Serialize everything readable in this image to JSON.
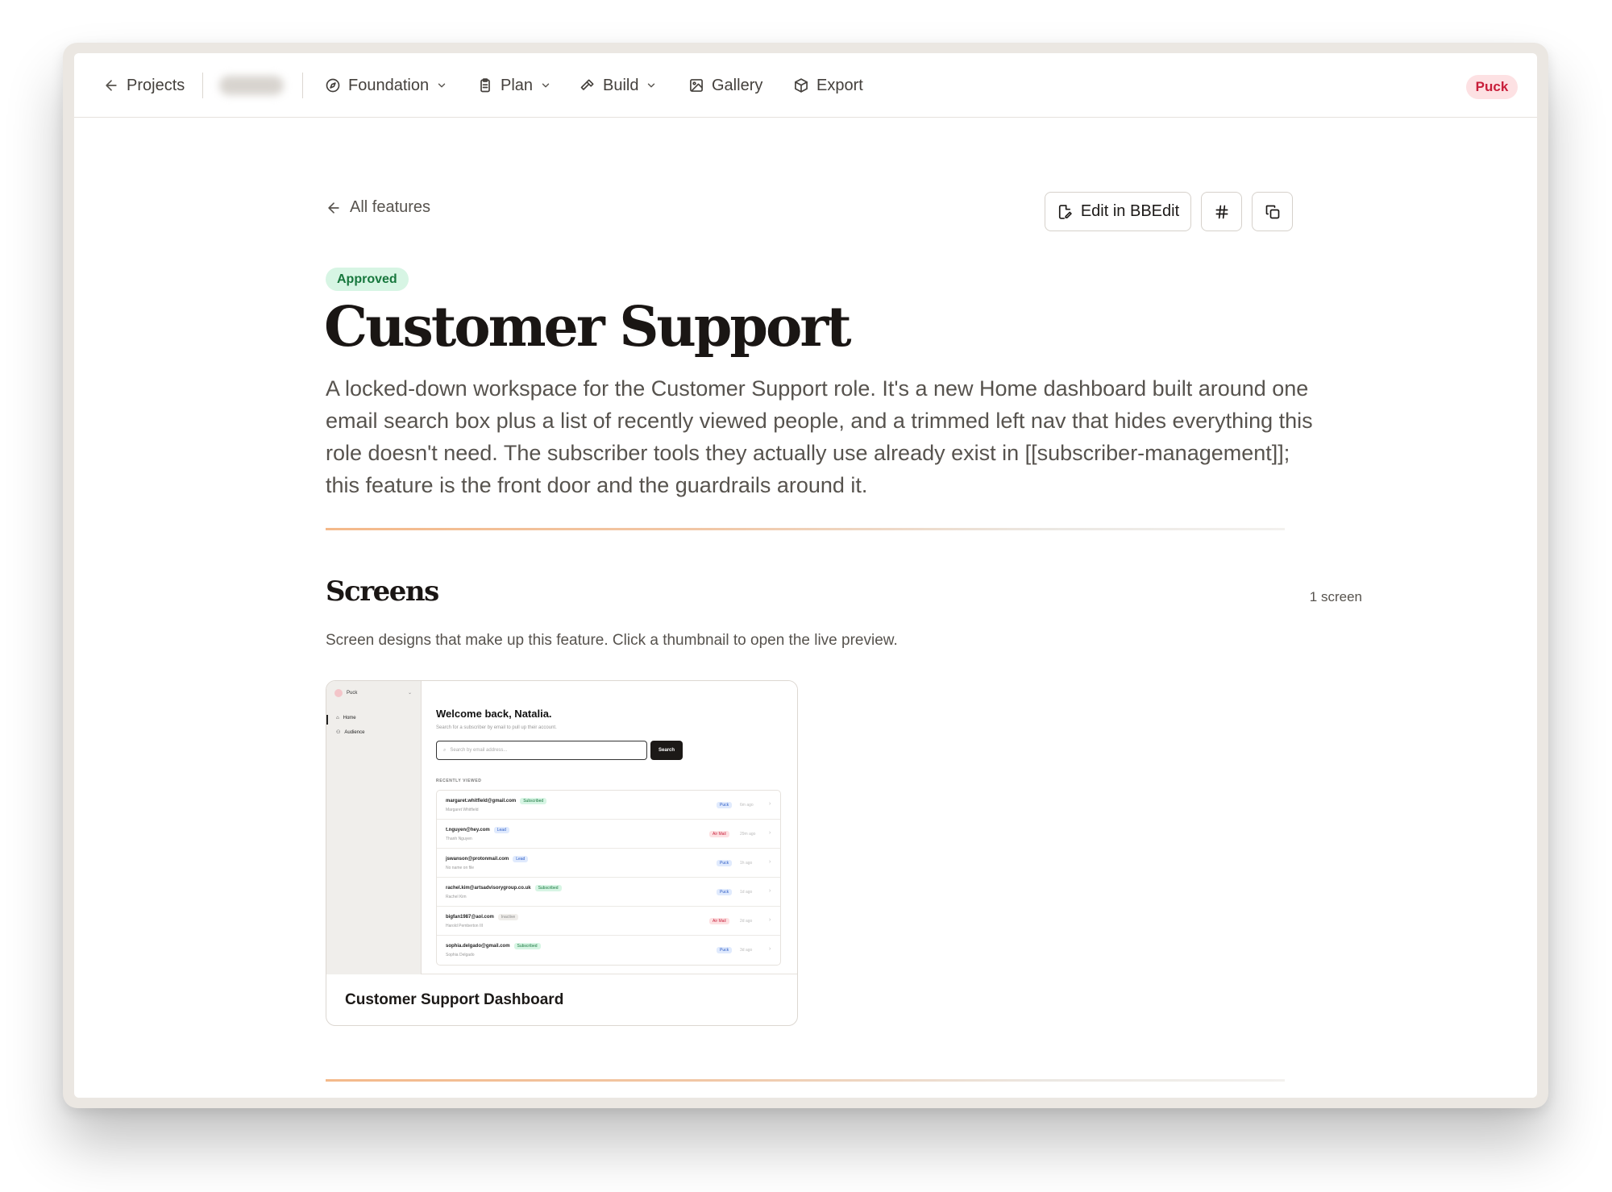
{
  "nav": {
    "projects": "Projects",
    "foundation": "Foundation",
    "plan": "Plan",
    "build": "Build",
    "gallery": "Gallery",
    "export": "Export",
    "user": "Puck"
  },
  "page": {
    "back_label": "All features",
    "edit_label": "Edit in BBEdit",
    "status": "Approved",
    "title": "Customer Support",
    "description": "A locked-down workspace for the Customer Support role. It's a new Home dashboard built around one email search box plus a list of recently viewed people, and a trimmed left nav that hides everything this role doesn't need. The subscriber tools they actually use already exist in [[subscriber-management]]; this feature is the front door and the guardrails around it."
  },
  "screens": {
    "title": "Screens",
    "count": "1 screen",
    "description": "Screen designs that make up this feature. Click a thumbnail to open the live preview.",
    "cards": [
      {
        "title": "Customer Support Dashboard",
        "preview": {
          "brand": "Puck",
          "nav": [
            "Home",
            "Audience"
          ],
          "heading": "Welcome back, Natalia.",
          "subheading": "Search for a subscriber by email to pull up their account.",
          "search_placeholder": "Search by email address...",
          "search_button": "Search",
          "recent_label": "RECENTLY VIEWED",
          "rows": [
            {
              "email": "margaret.whitfield@gmail.com",
              "status": "Subscribed",
              "name": "Margaret Whitfield",
              "tag": "Puck",
              "time": "6m ago"
            },
            {
              "email": "t.nguyen@hey.com",
              "status": "Lead",
              "name": "Thanh Nguyen",
              "tag": "Air Mail",
              "time": "29m ago"
            },
            {
              "email": "jswanson@protonmail.com",
              "status": "Lead",
              "name": "No name on file",
              "tag": "Puck",
              "time": "1h ago"
            },
            {
              "email": "rachel.kim@artsadvisorygroup.co.uk",
              "status": "Subscribed",
              "name": "Rachel Kim",
              "tag": "Puck",
              "time": "1d ago"
            },
            {
              "email": "bigfan1987@aol.com",
              "status": "Inactive",
              "name": "Harold Pemberton III",
              "tag": "Air Mail",
              "time": "2d ago"
            },
            {
              "email": "sophia.delgado@gmail.com",
              "status": "Subscribed",
              "name": "Sophia Delgado",
              "tag": "Puck",
              "time": "3d ago"
            }
          ]
        }
      }
    ]
  },
  "colors": {
    "accent": "#f4b98a",
    "approved_bg": "#d7f5e4",
    "approved_text": "#17773d",
    "user_pill_bg": "#fde1e3",
    "user_pill_text": "#c81e3a"
  },
  "icons": {
    "projects": "arrow-left-icon",
    "foundation": "compass-icon",
    "plan": "clipboard-icon",
    "build": "hammer-icon",
    "gallery": "image-icon",
    "export": "package-icon",
    "edit": "file-edit-icon",
    "anchor": "hash-icon",
    "copy": "copy-icon"
  }
}
